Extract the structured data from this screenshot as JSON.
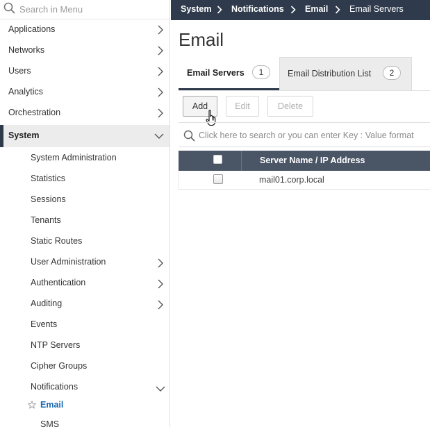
{
  "sidebar": {
    "search_placeholder": "Search in Menu",
    "items": [
      {
        "label": "Applications"
      },
      {
        "label": "Networks"
      },
      {
        "label": "Users"
      },
      {
        "label": "Analytics"
      },
      {
        "label": "Orchestration"
      },
      {
        "label": "System"
      }
    ],
    "sub_items": [
      {
        "label": "System Administration"
      },
      {
        "label": "Statistics"
      },
      {
        "label": "Sessions"
      },
      {
        "label": "Tenants"
      },
      {
        "label": "Static Routes"
      },
      {
        "label": "User Administration"
      },
      {
        "label": "Authentication"
      },
      {
        "label": "Auditing"
      },
      {
        "label": "Events"
      },
      {
        "label": "NTP Servers"
      },
      {
        "label": "Cipher Groups"
      },
      {
        "label": "Notifications"
      },
      {
        "label": "Email"
      },
      {
        "label": "SMS"
      }
    ]
  },
  "breadcrumb": [
    "System",
    "Notifications",
    "Email",
    "Email Servers"
  ],
  "page_title": "Email",
  "tabs": [
    {
      "label": "Email Servers",
      "count": "1"
    },
    {
      "label": "Email Distribution List",
      "count": "2"
    }
  ],
  "toolbar": {
    "add_label": "Add",
    "edit_label": "Edit",
    "delete_label": "Delete"
  },
  "search": {
    "placeholder": "Click here to search or you can enter Key : Value format"
  },
  "table": {
    "columns": [
      "Server Name / IP Address"
    ],
    "rows": [
      {
        "server": "mail01.corp.local"
      }
    ]
  },
  "colors": {
    "topbar": "#2f3b4c",
    "table_header": "#4a5566",
    "active_link": "#1a6ab3"
  }
}
